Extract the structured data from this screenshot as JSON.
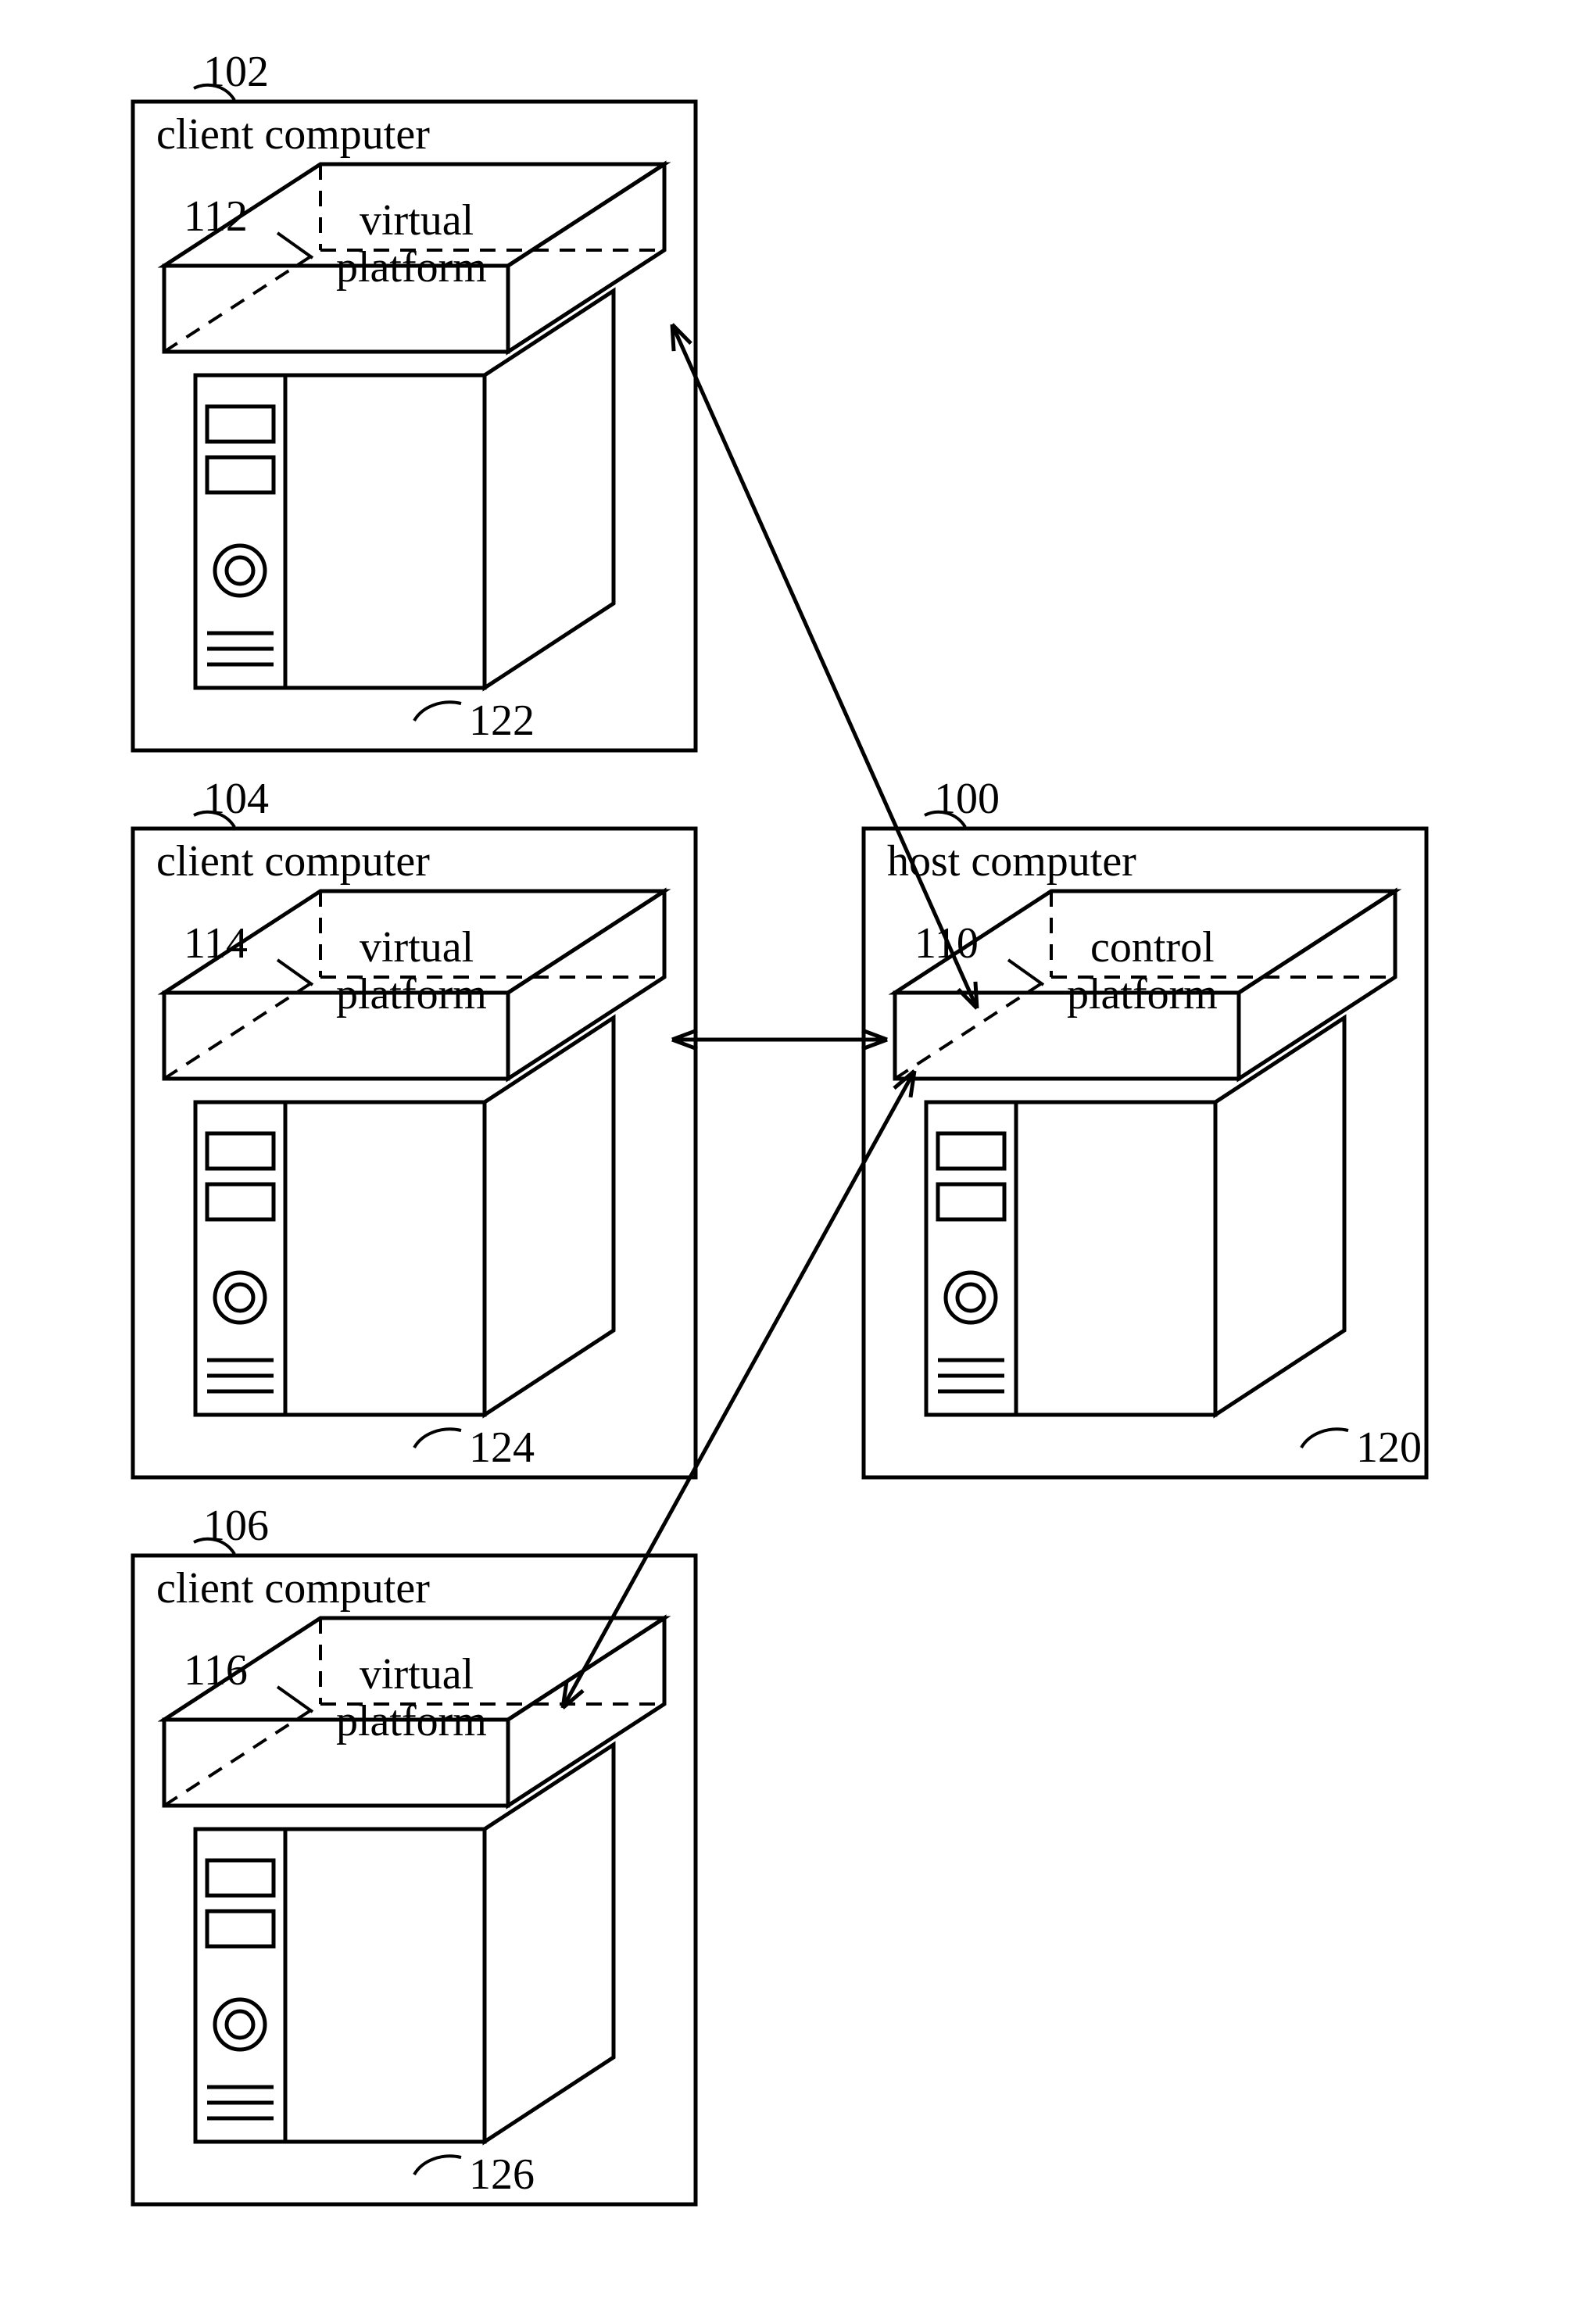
{
  "nodes": {
    "client_a": {
      "ref": "102",
      "title": "client computer",
      "platform_ref": "112",
      "platform_line1": "virtual",
      "platform_line2": "platform",
      "body_ref": "122"
    },
    "client_b": {
      "ref": "104",
      "title": "client computer",
      "platform_ref": "114",
      "platform_line1": "virtual",
      "platform_line2": "platform",
      "body_ref": "124"
    },
    "client_c": {
      "ref": "106",
      "title": "client computer",
      "platform_ref": "116",
      "platform_line1": "virtual",
      "platform_line2": "platform",
      "body_ref": "126"
    },
    "host": {
      "ref": "100",
      "title": "host computer",
      "platform_ref": "110",
      "platform_line1": "control",
      "platform_line2": "platform",
      "body_ref": "120"
    }
  }
}
